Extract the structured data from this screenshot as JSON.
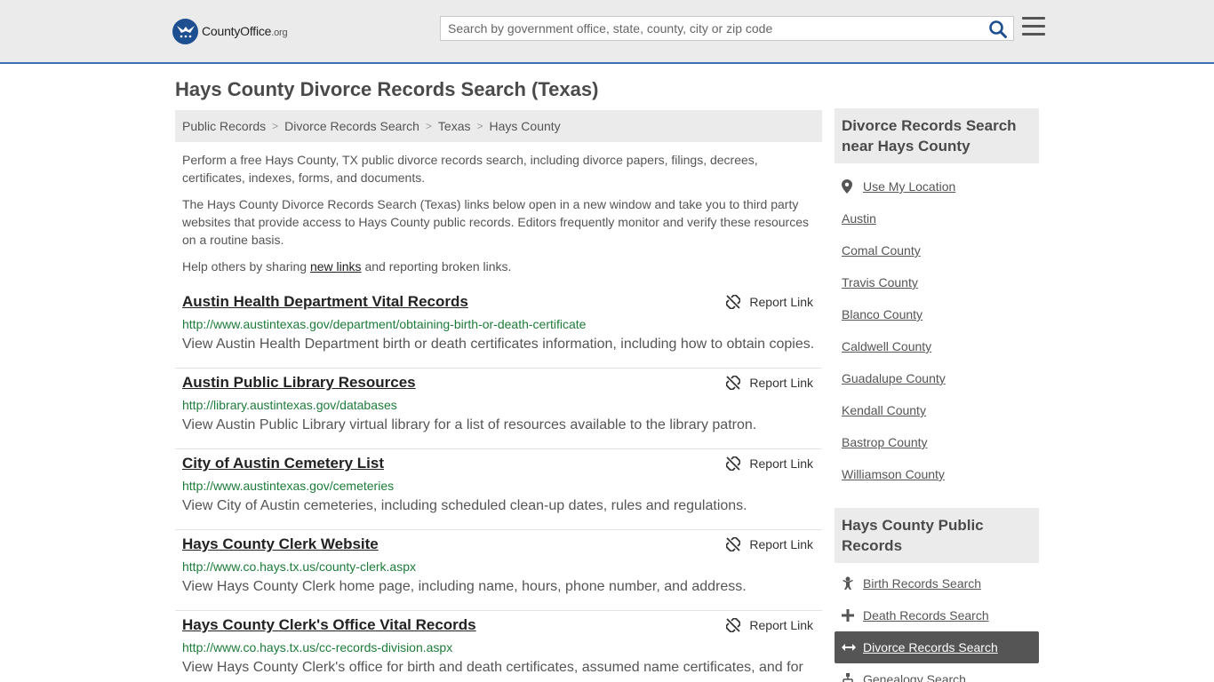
{
  "header": {
    "logo_name": "CountyOffice",
    "logo_tld": ".org",
    "search_placeholder": "Search by government office, state, county, city or zip code"
  },
  "page_title": "Hays County Divorce Records Search (Texas)",
  "breadcrumb": [
    "Public Records",
    "Divorce Records Search",
    "Texas",
    "Hays County"
  ],
  "intro": {
    "p1": "Perform a free Hays County, TX public divorce records search, including divorce papers, filings, decrees, certificates, indexes, forms, and documents.",
    "p2": "The Hays County Divorce Records Search (Texas) links below open in a new window and take you to third party websites that provide access to Hays County public records. Editors frequently monitor and verify these resources on a routine basis.",
    "p3_before": "Help others by sharing ",
    "p3_link": "new links",
    "p3_after": " and reporting broken links."
  },
  "report_label": "Report Link",
  "results": [
    {
      "title": "Austin Health Department Vital Records",
      "url": "http://www.austintexas.gov/department/obtaining-birth-or-death-certificate",
      "desc": "View Austin Health Department birth or death certificates information, including how to obtain copies."
    },
    {
      "title": "Austin Public Library Resources",
      "url": "http://library.austintexas.gov/databases",
      "desc": "View Austin Public Library virtual library for a list of resources available to the library patron."
    },
    {
      "title": "City of Austin Cemetery List",
      "url": "http://www.austintexas.gov/cemeteries",
      "desc": "View City of Austin cemeteries, including scheduled clean-up dates, rules and regulations."
    },
    {
      "title": "Hays County Clerk Website",
      "url": "http://www.co.hays.tx.us/county-clerk.aspx",
      "desc": "View Hays County Clerk home page, including name, hours, phone number, and address."
    },
    {
      "title": "Hays County Clerk's Office Vital Records",
      "url": "http://www.co.hays.tx.us/cc-records-division.aspx",
      "desc": "View Hays County Clerk's office for birth and death certificates, assumed name certificates, and for"
    }
  ],
  "sidebar_nearby": {
    "heading": "Divorce Records Search near Hays County",
    "use_location": "Use My Location",
    "items": [
      "Austin",
      "Comal County",
      "Travis County",
      "Blanco County",
      "Caldwell County",
      "Guadalupe County",
      "Kendall County",
      "Bastrop County",
      "Williamson County"
    ]
  },
  "sidebar_records": {
    "heading": "Hays County Public Records",
    "items": [
      {
        "label": "Birth Records Search",
        "icon": "baby-icon",
        "active": false
      },
      {
        "label": "Death Records Search",
        "icon": "plus-icon",
        "active": false
      },
      {
        "label": "Divorce Records Search",
        "icon": "arrows-horizontal-icon",
        "active": true
      },
      {
        "label": "Genealogy Search",
        "icon": "tree-icon",
        "active": false
      }
    ]
  },
  "colors": {
    "accent": "#3b70b4",
    "url_green": "#1d7c3a",
    "active_bg": "#555555"
  }
}
